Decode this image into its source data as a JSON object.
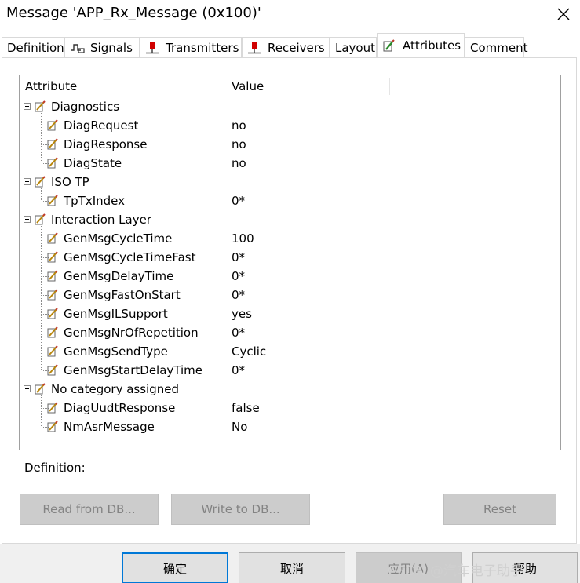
{
  "window": {
    "title": "Message 'APP_Rx_Message (0x100)'",
    "close_icon": "close-icon"
  },
  "tabs": [
    {
      "label": "Definition",
      "icon": ""
    },
    {
      "label": "Signals",
      "icon": "signals-icon"
    },
    {
      "label": "Transmitters",
      "icon": "transmitter-icon"
    },
    {
      "label": "Receivers",
      "icon": "receiver-icon"
    },
    {
      "label": "Layout",
      "icon": ""
    },
    {
      "label": "Attributes",
      "icon": "attribute-pencil-icon",
      "active": true
    },
    {
      "label": "Comment",
      "icon": ""
    }
  ],
  "table": {
    "headers": {
      "attribute": "Attribute",
      "value": "Value"
    },
    "groups": [
      {
        "name": "Diagnostics",
        "items": [
          {
            "name": "DiagRequest",
            "value": "no"
          },
          {
            "name": "DiagResponse",
            "value": "no"
          },
          {
            "name": "DiagState",
            "value": "no"
          }
        ]
      },
      {
        "name": "ISO TP",
        "items": [
          {
            "name": "TpTxIndex",
            "value": "0*"
          }
        ]
      },
      {
        "name": "Interaction Layer",
        "items": [
          {
            "name": "GenMsgCycleTime",
            "value": "100"
          },
          {
            "name": "GenMsgCycleTimeFast",
            "value": "0*"
          },
          {
            "name": "GenMsgDelayTime",
            "value": "0*"
          },
          {
            "name": "GenMsgFastOnStart",
            "value": "0*"
          },
          {
            "name": "GenMsgILSupport",
            "value": "yes"
          },
          {
            "name": "GenMsgNrOfRepetition",
            "value": "0*"
          },
          {
            "name": "GenMsgSendType",
            "value": "Cyclic"
          },
          {
            "name": "GenMsgStartDelayTime",
            "value": "0*"
          }
        ]
      },
      {
        "name": "No category assigned",
        "items": [
          {
            "name": "DiagUudtResponse",
            "value": "false"
          },
          {
            "name": "NmAsrMessage",
            "value": "No"
          }
        ]
      }
    ]
  },
  "definition_label": "Definition:",
  "actions": {
    "read_from_db": "Read from DB...",
    "write_to_db": "Write to DB...",
    "reset": "Reset"
  },
  "footer": {
    "ok": "确定",
    "cancel": "取消",
    "apply": "应用(A)",
    "help": "帮助"
  },
  "watermark": "CSDN @汽车电子助手",
  "colors": {
    "accent_blue": "#0078d7",
    "pencil_red": "#c0392b",
    "disabled_bg": "#cccccc"
  }
}
